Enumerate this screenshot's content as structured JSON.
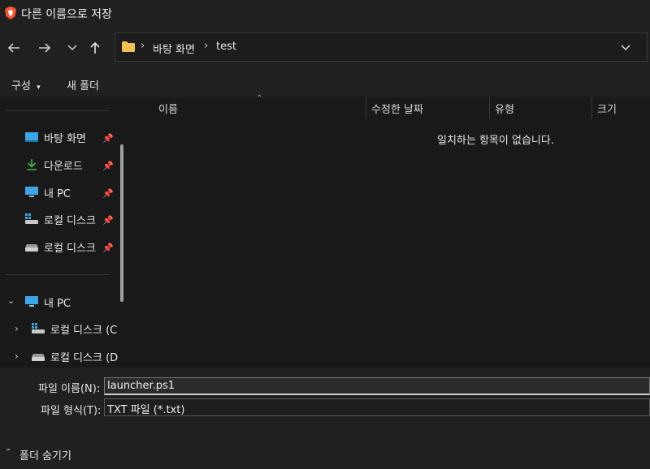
{
  "window": {
    "title": "다른 이름으로 저장"
  },
  "address": {
    "crumbs": [
      "바탕 화면",
      "test"
    ]
  },
  "toolbar": {
    "organize_label": "구성",
    "new_folder_label": "새 폴더"
  },
  "nav": {
    "quick_access": [
      {
        "label": "바탕 화면",
        "icon": "desktop-icon"
      },
      {
        "label": "다운로드",
        "icon": "download-icon"
      },
      {
        "label": "내 PC",
        "icon": "pc-icon"
      },
      {
        "label": "로컬 디스크",
        "icon": "system-drive-icon"
      },
      {
        "label": "로컬 디스크",
        "icon": "drive-icon"
      }
    ],
    "this_pc": {
      "label": "내 PC",
      "children": [
        {
          "label": "로컬 디스크 (C",
          "icon": "system-drive-icon"
        },
        {
          "label": "로컬 디스크 (D",
          "icon": "drive-icon"
        }
      ]
    }
  },
  "list": {
    "columns": [
      "이름",
      "수정한 날짜",
      "유형",
      "크기"
    ],
    "empty_message": "일치하는 항목이 없습니다."
  },
  "save": {
    "filename_label": "파일 이름(N):",
    "filename_value": "launcher.ps1",
    "filetype_label": "파일 형식(T):",
    "filetype_value": "TXT 파일 (*.txt)",
    "hide_folders_label": "폴더 숨기기"
  },
  "colors": {
    "accent_folder": "#f2c14e",
    "download_green": "#3fb950",
    "pc_blue": "#3ea6e6"
  }
}
